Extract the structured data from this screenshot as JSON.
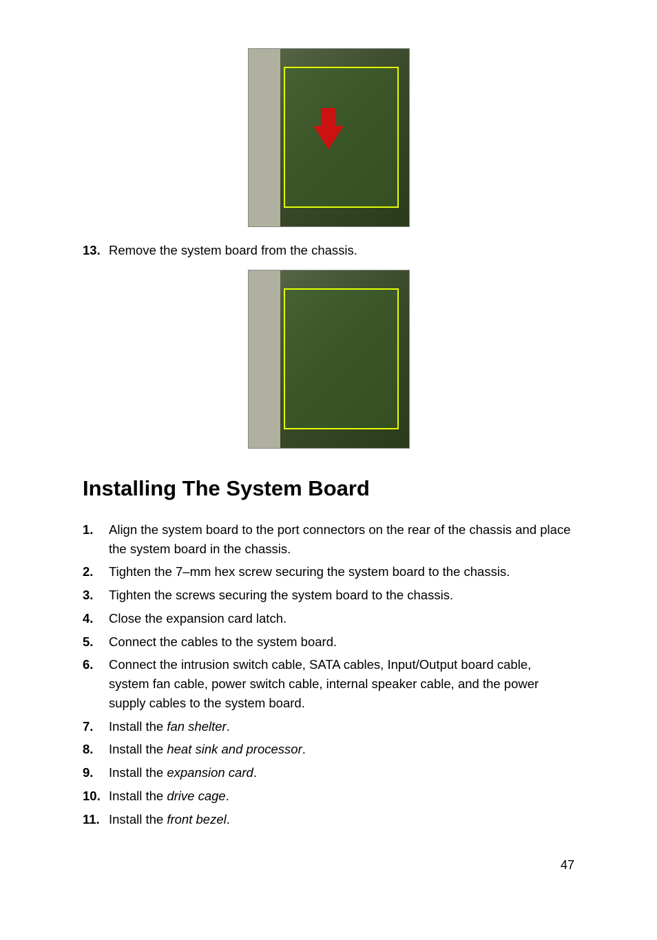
{
  "steps_before": [
    {
      "num": "13.",
      "text": "Remove the system board from the chassis."
    }
  ],
  "heading": "Installing The System Board",
  "install_steps": [
    {
      "num": "1.",
      "text": "Align the system board to the port connectors on the rear of the chassis and place the system board in the chassis."
    },
    {
      "num": "2.",
      "text": "Tighten the 7–mm hex screw securing the system board to the chassis."
    },
    {
      "num": "3.",
      "text": "Tighten the screws securing the system board to the chassis."
    },
    {
      "num": "4.",
      "text": "Close the expansion card latch."
    },
    {
      "num": "5.",
      "text": "Connect the cables to the system board."
    },
    {
      "num": "6.",
      "text": "Connect the intrusion switch cable, SATA cables, Input/Output board cable, system fan cable, power switch cable, internal speaker cable, and the power supply cables to the system board."
    },
    {
      "num": "7.",
      "prefix": "Install the ",
      "italic": "fan shelter",
      "suffix": "."
    },
    {
      "num": "8.",
      "prefix": "Install the ",
      "italic": "heat sink and processor",
      "suffix": "."
    },
    {
      "num": "9.",
      "prefix": "Install the ",
      "italic": "expansion card",
      "suffix": "."
    },
    {
      "num": "10.",
      "prefix": "Install the ",
      "italic": "drive cage",
      "suffix": "."
    },
    {
      "num": "11.",
      "prefix": "Install the ",
      "italic": "front bezel",
      "suffix": "."
    }
  ],
  "page_number": "47"
}
